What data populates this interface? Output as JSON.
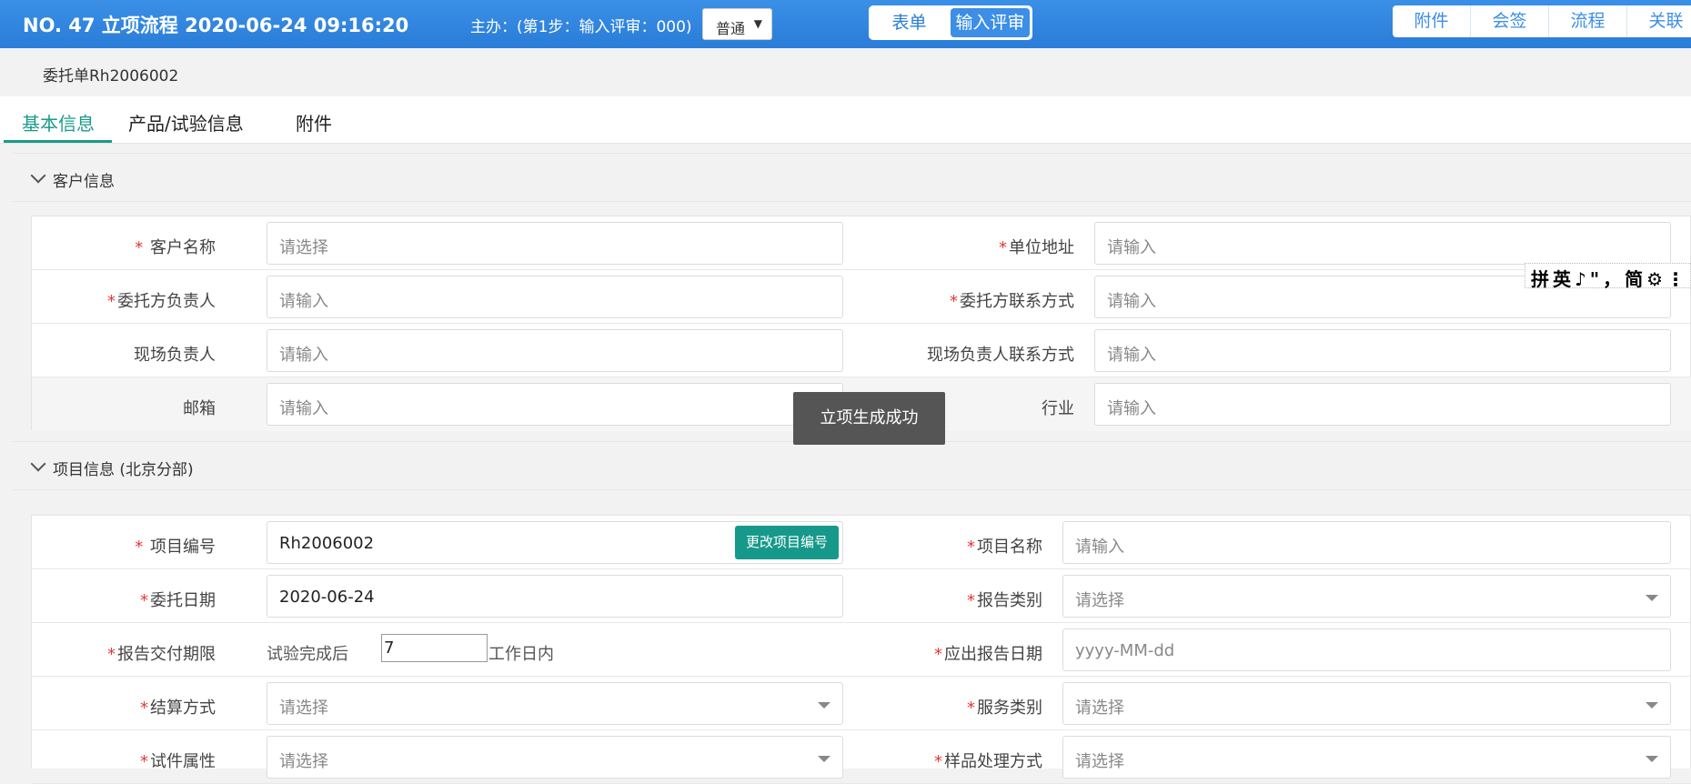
{
  "header": {
    "title": "NO. 47 立项流程 2020-06-24 09:16:20",
    "step_text": "主办：(第1步：输入评审：000)",
    "level_select": "普通",
    "segments": [
      "表单",
      "输入评审"
    ],
    "right_tabs": [
      "附件",
      "会签",
      "流程",
      "关联"
    ]
  },
  "subtitle": "委托单Rh2006002",
  "tabs": [
    "基本信息",
    "产品/试验信息",
    "附件"
  ],
  "customer_section": {
    "label": "客户信息",
    "fields": [
      {
        "label": "客户名称",
        "placeholder": "请选择"
      },
      {
        "label": "单位地址",
        "placeholder": "请输入"
      },
      {
        "label": "委托方负责人",
        "placeholder": "请输入"
      },
      {
        "label": "委托方联系方式",
        "placeholder": "请输入"
      },
      {
        "label": "现场负责人",
        "placeholder": "请输入"
      },
      {
        "label": "现场负责人联系方式",
        "placeholder": "请输入"
      },
      {
        "label": "邮箱",
        "placeholder": "请输入"
      },
      {
        "label": "行业",
        "placeholder": "请输入"
      }
    ]
  },
  "project_section": {
    "label": "项目信息 (北京分部)",
    "project_no_label": "项目编号",
    "project_no_value": "Rh2006002",
    "change_button": "更改项目编号",
    "project_name_label": "项目名称",
    "project_name_placeholder": "请输入",
    "commission_date_label": "委托日期",
    "commission_date_value": "2020-06-24",
    "report_type_label": "报告类别",
    "report_type_placeholder": "请选择",
    "deadline_label": "报告交付期限",
    "deadline_prefix": "试验完成后",
    "deadline_value": "7",
    "deadline_suffix": "工作日内",
    "due_date_label": "应出报告日期",
    "due_date_placeholder": "yyyy-MM-dd",
    "settlement_label": "结算方式",
    "settlement_placeholder": "请选择",
    "service_label": "服务类别",
    "service_placeholder": "请选择",
    "sample_attr_label": "试件属性",
    "sample_attr_placeholder": "请选择",
    "sample_handling_label": "样品处理方式",
    "sample_handling_placeholder": "请选择"
  },
  "toast": "立项生成成功",
  "ime_toolbar": "拼英♪\"，简⚙⋮"
}
